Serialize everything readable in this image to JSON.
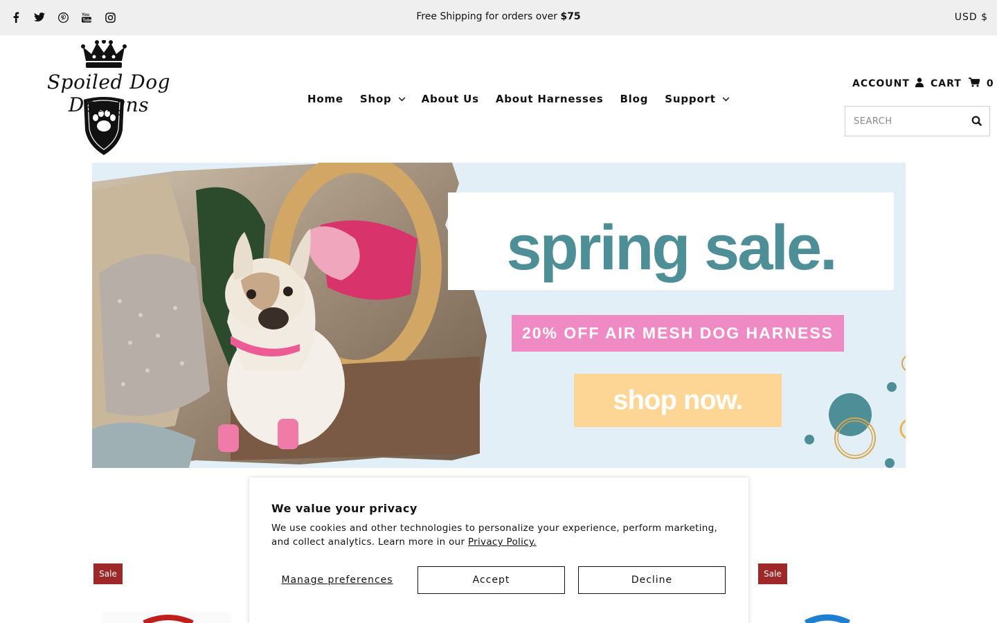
{
  "topbar": {
    "social_icons": [
      "facebook-icon",
      "twitter-icon",
      "pinterest-icon",
      "youtube-icon",
      "instagram-icon"
    ],
    "announcement_prefix": "Free Shipping for orders over ",
    "announcement_amount": "$75",
    "currency": "USD $"
  },
  "header": {
    "logo_text": "Spoiled Dog Designs",
    "nav": [
      {
        "label": "Home",
        "has_dropdown": false
      },
      {
        "label": "Shop",
        "has_dropdown": true
      },
      {
        "label": "About Us",
        "has_dropdown": false
      },
      {
        "label": "About Harnesses",
        "has_dropdown": false
      },
      {
        "label": "Blog",
        "has_dropdown": false
      },
      {
        "label": "Support",
        "has_dropdown": true
      }
    ],
    "account_label": "ACCOUNT",
    "cart_label": "CART",
    "cart_count": "0",
    "search_placeholder": "SEARCH"
  },
  "hero": {
    "headline": "spring sale.",
    "promo": "20% OFF AIR MESH DOG HARNESS",
    "cta": "shop now.",
    "colors": {
      "background": "#e3eff7",
      "headline": "#4e8f97",
      "promo_bg": "#f08ac4",
      "cta_bg": "#fdd695"
    }
  },
  "products": {
    "badges": [
      "Sale",
      "Sale"
    ],
    "badge_color": "#9e2727"
  },
  "cookie": {
    "title": "We value your privacy",
    "body": "We use cookies and other technologies to personalize your experience, perform marketing, and collect analytics. Learn more in our ",
    "policy_link": "Privacy Policy.",
    "manage_label": "Manage preferences",
    "accept_label": "Accept",
    "decline_label": "Decline"
  }
}
